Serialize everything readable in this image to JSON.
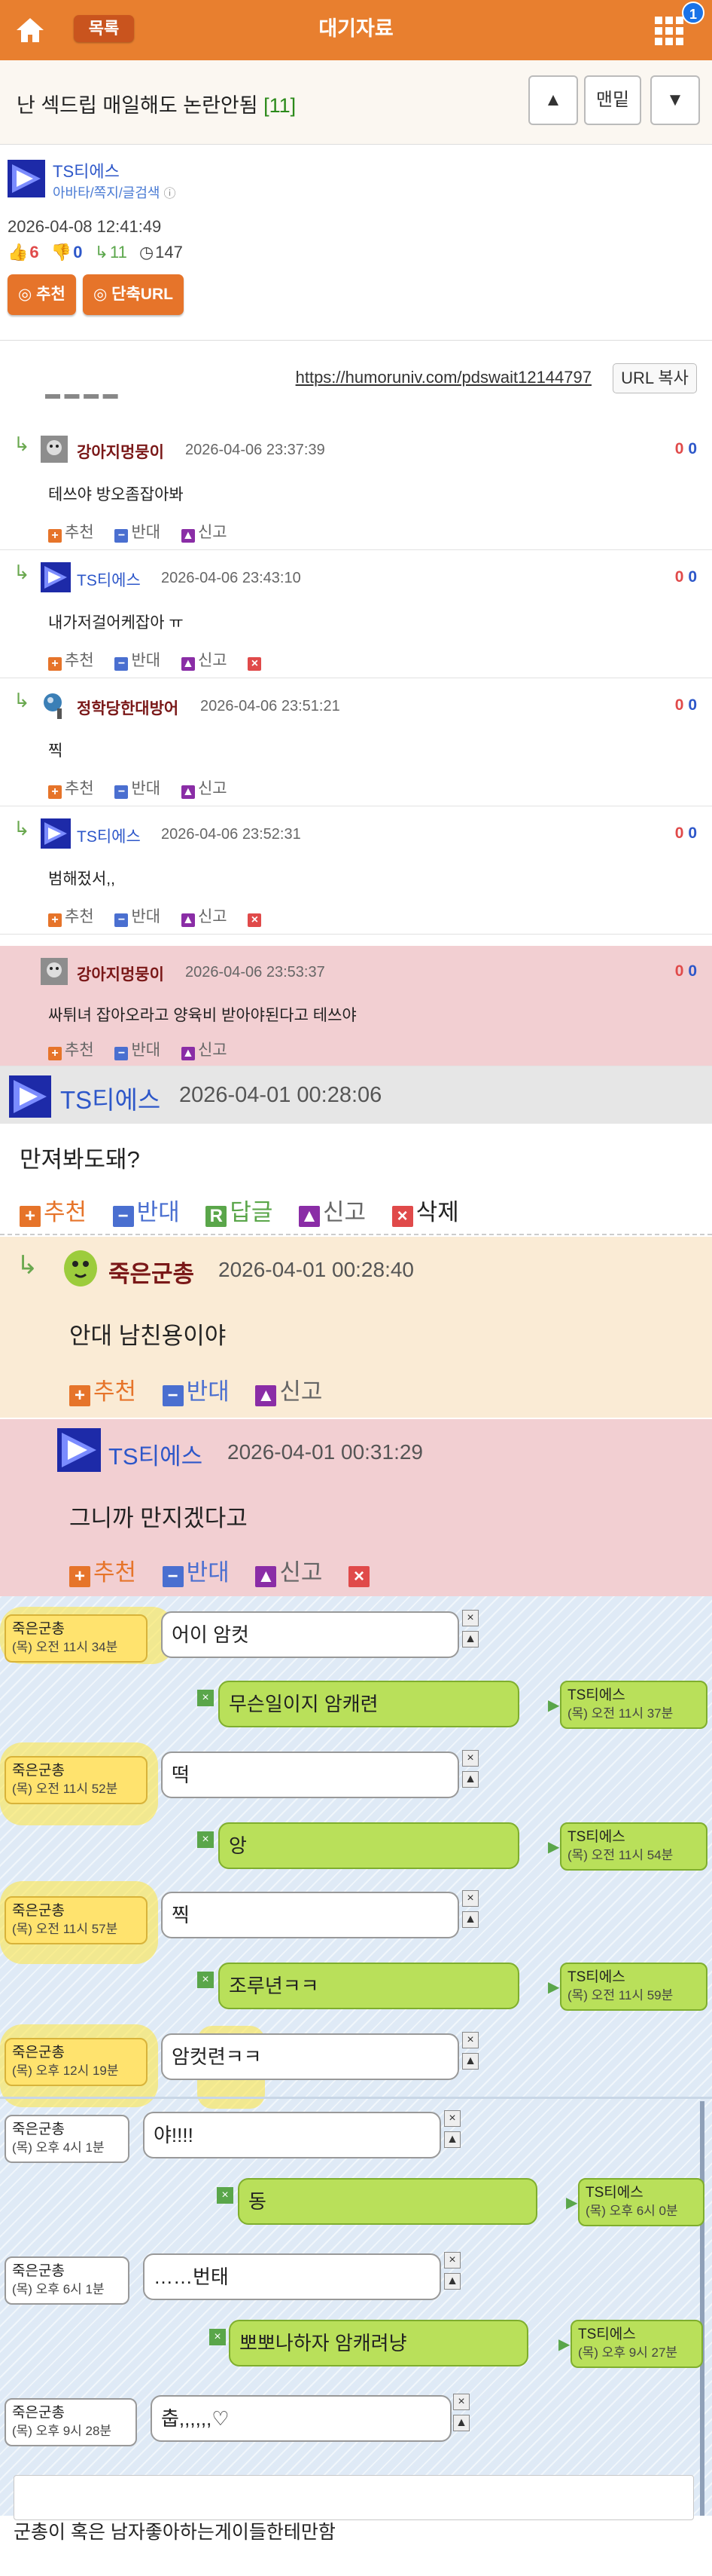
{
  "topbar": {
    "title": "대기자료",
    "list_label": "목록",
    "badge": "1"
  },
  "post": {
    "title": "난 섹드립 매일해도 논란안됨",
    "comment_count": "[11]",
    "nav_up": "▲",
    "nav_bottom": "맨밑",
    "nav_down": "▼"
  },
  "author": {
    "name": "TS티에스",
    "sub": "아바타/쪽지/글검색",
    "date": "2026-04-08 12:41:49",
    "up": "6",
    "down": "0",
    "reply": "11",
    "views": "147",
    "recommend_btn": "◎ 추천",
    "short_url_btn": "◎ 단축URL"
  },
  "url": {
    "link": "https://humoruniv.com/pdswait12144797",
    "copy": "URL 복사"
  },
  "actions": {
    "up": "추천",
    "down": "반대",
    "report": "신고",
    "reply": "답글",
    "delete": "삭제"
  },
  "comments": [
    {
      "nick": "강아지멍뭉이",
      "time": "2026-04-06 23:37:39",
      "text": "테쓰야 방오좀잡아봐",
      "up": "0",
      "down": "0"
    },
    {
      "nick": "TS티에스",
      "time": "2026-04-06 23:43:10",
      "text": "내가저걸어케잡아 ㅠ",
      "up": "0",
      "down": "0"
    },
    {
      "nick": "정학당한대방어",
      "time": "2026-04-06 23:51:21",
      "text": "찍",
      "up": "0",
      "down": "0"
    },
    {
      "nick": "TS티에스",
      "time": "2026-04-06 23:52:31",
      "text": "범해젔서,,",
      "up": "0",
      "down": "0"
    },
    {
      "nick": "강아지멍뭉이",
      "time": "2026-04-06 23:53:37",
      "text": "싸튀녀 잡아오라고 양육비 받아야된다고 테쓰야",
      "up": "0",
      "down": "0"
    }
  ],
  "big_comments": [
    {
      "nick": "TS티에스",
      "time": "2026-04-01 00:28:06",
      "text": "만져봐도돼?"
    },
    {
      "nick": "죽은군총",
      "time": "2026-04-01 00:28:40",
      "text": "안대 남친용이야"
    },
    {
      "nick": "TS티에스",
      "time": "2026-04-01 00:31:29",
      "text": "그니까 만지겠다고"
    }
  ],
  "chat": [
    {
      "side": "left",
      "name": "죽은군총",
      "time": "(목) 오전 11시 34분",
      "text": "어이 암컷"
    },
    {
      "side": "right",
      "name": "TS티에스",
      "time": "(목) 오전 11시 37분",
      "text": "무슨일이지 암캐련"
    },
    {
      "side": "left",
      "name": "죽은군총",
      "time": "(목) 오전 11시 52분",
      "text": "떡"
    },
    {
      "side": "right",
      "name": "TS티에스",
      "time": "(목) 오전 11시 54분",
      "text": "앙"
    },
    {
      "side": "left",
      "name": "죽은군총",
      "time": "(목) 오전 11시 57분",
      "text": "찍"
    },
    {
      "side": "right",
      "name": "TS티에스",
      "time": "(목) 오전 11시 59분",
      "text": "조루년ㅋㅋ"
    },
    {
      "side": "left",
      "name": "죽은군총",
      "time": "(목) 오후 12시 19분",
      "text": "암컷련ㅋㅋ"
    },
    {
      "side": "left",
      "name": "죽은군총",
      "time": "(목) 오후 4시 1분",
      "text": "야!!!!"
    },
    {
      "side": "right",
      "name": "TS티에스",
      "time": "(목) 오후 6시 0분",
      "text": "동"
    },
    {
      "side": "left",
      "name": "죽은군총",
      "time": "(목) 오후 6시 1분",
      "text": "……번태"
    },
    {
      "side": "right",
      "name": "TS티에스",
      "time": "(목) 오후 9시 27분",
      "text": "뽀뽀나하자 암캐려냥"
    },
    {
      "side": "left",
      "name": "죽은군총",
      "time": "(목) 오후 9시 28분",
      "text": "춥,,,,,,♡"
    }
  ],
  "bottom_text": "군총이 혹은 남자좋아하는게이들한테만함",
  "colors": {
    "brand": "#e87f2f",
    "link": "#2d57c9",
    "highlight_row": "#f2cfd2",
    "reply_row": "#faebd5"
  }
}
